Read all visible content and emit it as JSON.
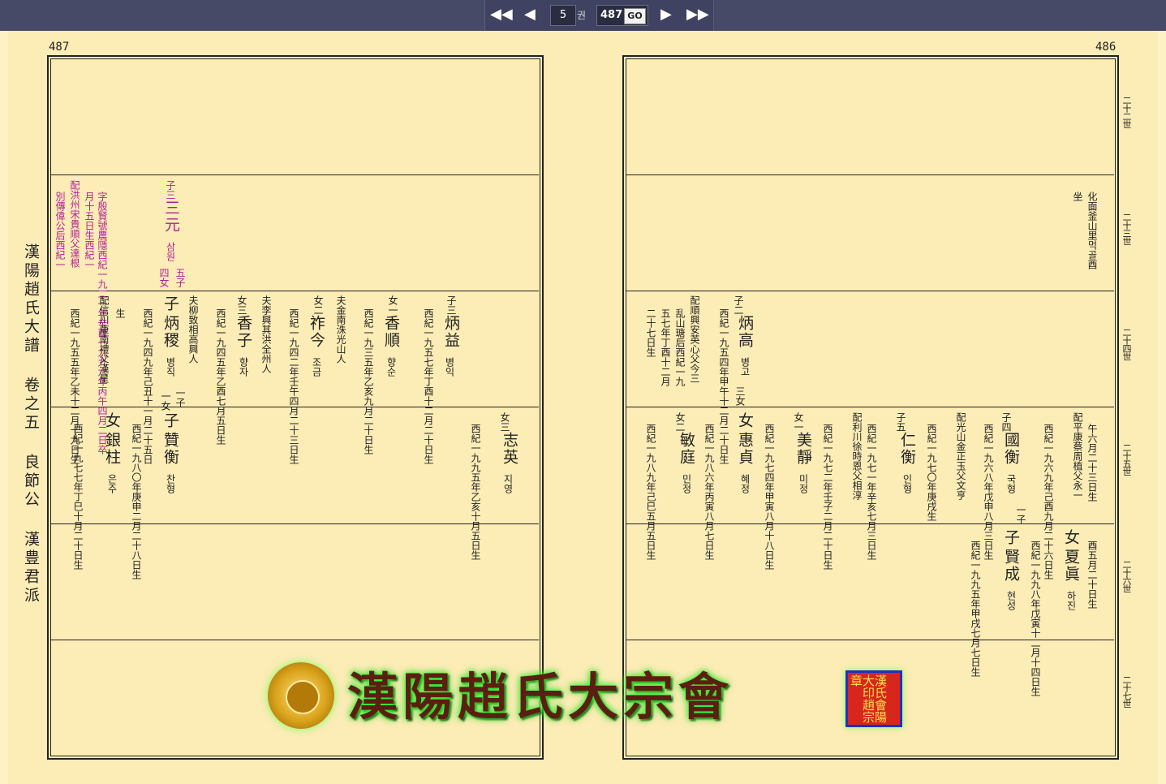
{
  "toolbar": {
    "first_icon": "double-left-arrow-icon",
    "prev_icon": "left-arrow-icon",
    "page_value": "5",
    "kwon_label": "권",
    "total_pages": "487",
    "go_label": "GO",
    "next_icon": "right-arrow-icon",
    "last_icon": "double-right-arrow-icon"
  },
  "left_page": {
    "page_number": "487",
    "side_title": "漢陽趙氏大譜 卷之五 良節公 漢豊君派"
  },
  "right_page": {
    "page_number": "486",
    "generations": [
      "二十二世",
      "二十三世",
      "二十四世",
      "二十五世",
      "二十六世",
      "二十七世"
    ]
  },
  "entries": {
    "l_r2": [
      [
        "子三",
        "三元",
        "삼원",
        "五子",
        "四女",
        "字殷賢號農隱西紀一九二一年辛酉一九九六年丙午四月二日卒",
        "月十五日生西紀一",
        "配洪州宋貴順父達根",
        "別傳偉公后西紀一"
      ]
    ],
    "l_r3": {
      "e1": [
        "子三",
        "炳益",
        "병익",
        "西紀一九五七年丁酉十二月二十日生"
      ],
      "e2": [
        "女一",
        "香順",
        "향순",
        "西紀一九三五年乙亥九月二十日生",
        "夫金南洙光山人"
      ],
      "e3": [
        "女二",
        "祚今",
        "조금",
        "西紀一九四二年壬午四月二十三日生",
        "夫李興其洪全州人"
      ],
      "e4": [
        "女三",
        "香子",
        "향자",
        "西紀一九四五年乙酉七月五日生",
        "夫柳致相高興人"
      ],
      "e5": [
        "子",
        "炳稷",
        "병직",
        "一子",
        "一女",
        "西紀一九四九年己丑十一月二十五日",
        "生",
        "配信川康南禮父漢星",
        "西紀一九五五年乙未十二月十九日生"
      ]
    },
    "l_r4": {
      "e1": [
        "女三",
        "志英",
        "지영",
        "西紀一九九五年乙亥十月五日生"
      ],
      "e2": [
        "子",
        "贊衡",
        "찬형",
        "西紀一九八〇年庚申二月二十八日生"
      ],
      "e3": [
        "女",
        "銀柱",
        "은주",
        "西紀一九七七年丁巳十月二十日生"
      ]
    },
    "r_r2": [
      "化面釜山里먹골酉",
      "坐"
    ],
    "r_r3": [
      "子二",
      "炳高",
      "병고",
      "三女",
      "西紀一九五四年甲午十二月二十日生",
      "配順興安英心父今三",
      "乱山瑭后西紀一九",
      "五七年丁酉十二月",
      "二十七日生"
    ],
    "r_r4": {
      "e1": [
        "午六月二十三日生",
        "配平康蔡周植父永一",
        "西紀一九六九年己酉九月二十六日生"
      ],
      "e2": [
        "子四",
        "國衡",
        "국형",
        "一子",
        "西紀一九六八年戊申八月三日生",
        "配光山金正玉父文亨",
        "西紀一九七〇年庚戌生"
      ],
      "e3": [
        "子五",
        "仁衡",
        "인형",
        "西紀一九七一年辛亥七月三日生",
        "配利川徐時恩父相淳",
        "西紀一九七二年壬子二月二十日生"
      ],
      "e4": [
        "女一",
        "美靜",
        "미정",
        "西紀一九七四年甲寅八月十八日生"
      ],
      "e5": [
        "女",
        "惠貞",
        "혜정",
        "西紀一九八六年丙寅八月七日生"
      ],
      "e6": [
        "女二",
        "敏庭",
        "민정",
        "西紀一九八九年己巳五月五日生"
      ]
    },
    "r_r5": {
      "e1": [
        "酉五月二十日生"
      ],
      "e2": [
        "女",
        "夏眞",
        "하진",
        "西紀一九九八年戊寅十二月十四日生"
      ],
      "e3": [
        "子",
        "賢成",
        "현성",
        "西紀一九九五年甲戌七月七日生"
      ]
    }
  },
  "footer": {
    "logo_text": "漢陽趙氏大宗會",
    "seal_text": "漢氏會陽大印趙宗章",
    "emblem_icon": "plum-blossom-emblem-icon"
  }
}
